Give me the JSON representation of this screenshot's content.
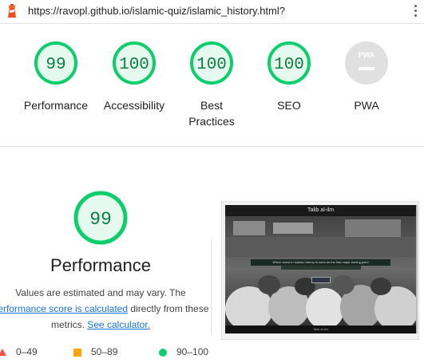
{
  "toolbar": {
    "url": "https://ravopl.github.io/islamic-quiz/islamic_history.html?",
    "icon": "lighthouse-icon",
    "menu_icon": "kebab-menu-icon"
  },
  "gauges": [
    {
      "score": "99",
      "label": "Performance"
    },
    {
      "score": "100",
      "label": "Accessibility"
    },
    {
      "score": "100",
      "label": "Best Practices"
    },
    {
      "score": "100",
      "label": "SEO"
    },
    {
      "score": "PWA",
      "label": "PWA"
    }
  ],
  "performance": {
    "score": "99",
    "title": "Performance",
    "desc_line1": "Values are estimated and may vary. The",
    "desc_link1": "performance score is calculated",
    "desc_line2_rest": " directly from these",
    "desc_line3": "metrics.",
    "desc_link2": "See calculator."
  },
  "legend": {
    "fail": "0–49",
    "average": "50–89",
    "pass": "90–100"
  },
  "screenshot": {
    "header": "Talib al-ilm",
    "banner": "Which event in Islamic history is seen as the first major turning point",
    "footer": "Talib al-ilm"
  },
  "colors": {
    "pass": "#0cce6b",
    "pass_text": "#0c8043",
    "average": "#ffa400",
    "fail": "#ff4e42",
    "link": "#1a73e8",
    "pwa_gray": "#e0e0e0"
  }
}
